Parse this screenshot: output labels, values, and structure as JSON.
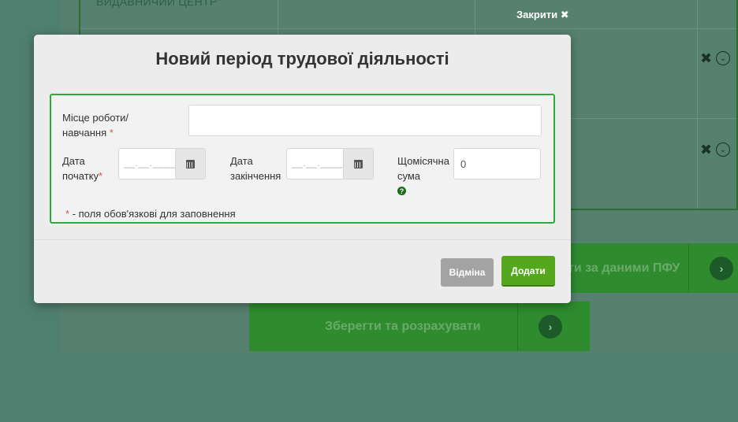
{
  "background": {
    "org_label": "ВИДАВНИЧИЙ ЦЕНТР\"",
    "close_label": "Закрити",
    "close_icon": "✖",
    "row_delete_icon": "✖",
    "row_expand_icon": "⌄",
    "pfu_button_label": "ти за даними ПФУ",
    "save_button_label": "Зберегти та розрахувати",
    "arrow_icon": "›"
  },
  "modal": {
    "title": "Новий період трудової діяльності",
    "workplace_label": "Місце роботи/ навчання",
    "workplace_value": "",
    "start_date_label": "Дата початку",
    "start_date_mask": "__.__.____",
    "end_date_label": "Дата закінчення",
    "end_date_mask": "__.__.____",
    "monthly_sum_label": "Щомісячна сума",
    "monthly_sum_value": "0",
    "help_icon": "?",
    "required_mark": "*",
    "required_note": "- поля обов'язкові для заповнення",
    "cancel_label": "Відміна",
    "add_label": "Додати"
  },
  "colors": {
    "overlay": "#4f7f6f",
    "form_border": "#2eaa3a",
    "add_button": "#55a81e",
    "cancel_button": "#a3a3a3",
    "required": "#d9534f"
  }
}
